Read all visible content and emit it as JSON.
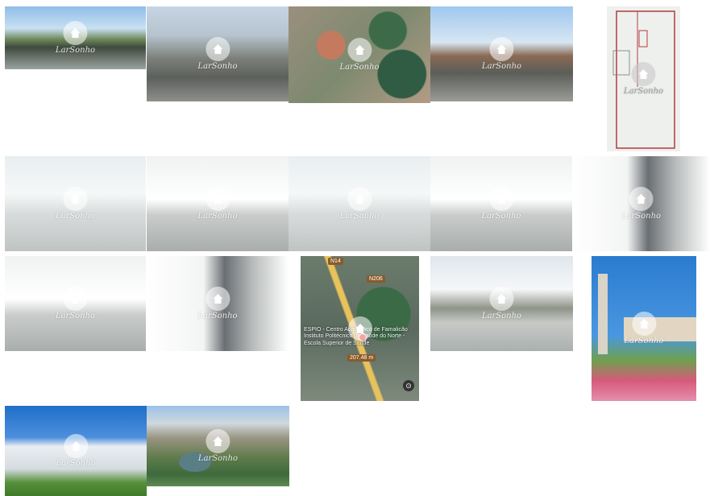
{
  "watermark": {
    "brand": "LarSonho"
  },
  "map_labels": {
    "road_top": "N14",
    "road_mid": "N206",
    "poi_line1": "ESPIO - Centro Académico de Famalicão",
    "poi_line2": "Instituto Politécnico de Saúde do Norte - Escola Superior de Saúde",
    "distance": "207.48 m"
  },
  "photos": [
    {
      "id": "p1",
      "scene": "street1"
    },
    {
      "id": "p2",
      "scene": "street2"
    },
    {
      "id": "p3",
      "scene": "aerial1"
    },
    {
      "id": "p4",
      "scene": "street3"
    },
    {
      "id": "p5",
      "scene": "plan"
    },
    {
      "id": "p6",
      "scene": "interior"
    },
    {
      "id": "p7",
      "scene": "interior2"
    },
    {
      "id": "p8",
      "scene": "interior"
    },
    {
      "id": "p9",
      "scene": "interior2"
    },
    {
      "id": "p10",
      "scene": "interior3"
    },
    {
      "id": "p11",
      "scene": "interior2"
    },
    {
      "id": "p12",
      "scene": "interior3"
    },
    {
      "id": "p13",
      "scene": "map2"
    },
    {
      "id": "p14",
      "scene": "market"
    },
    {
      "id": "p15",
      "scene": "tower"
    },
    {
      "id": "p16",
      "scene": "building"
    },
    {
      "id": "p17",
      "scene": "aerial2"
    }
  ]
}
